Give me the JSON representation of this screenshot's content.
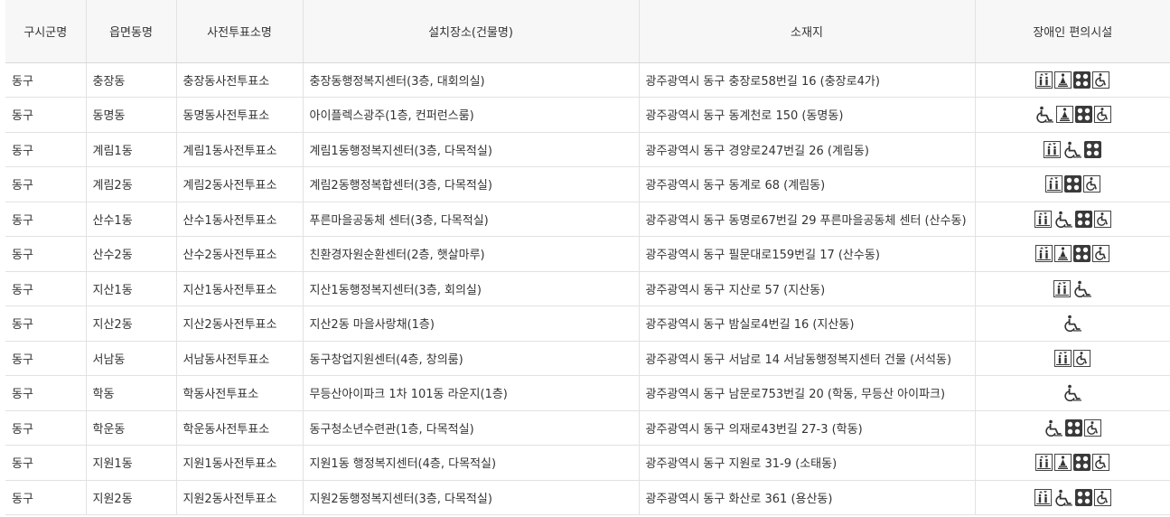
{
  "headers": [
    "구시군명",
    "읍면동명",
    "사전투표소명",
    "설치장소(건물명)",
    "소재지",
    "장애인 편의시설"
  ],
  "rows": [
    {
      "sigungu": "동구",
      "dong": "충장동",
      "station": "충장동사전투표소",
      "place": "충장동행정복지센터(3층, 대회의실)",
      "address": "광주광역시 동구 충장로58번길 16 (충장로4가)",
      "icons": [
        "elevator",
        "slope",
        "braille",
        "toilet"
      ]
    },
    {
      "sigungu": "동구",
      "dong": "동명동",
      "station": "동명동사전투표소",
      "place": "아이플렉스광주(1층, 컨퍼런스룸)",
      "address": "광주광역시 동구 동계천로 150 (동명동)",
      "icons": [
        "wheelchair",
        "slope",
        "braille",
        "toilet"
      ]
    },
    {
      "sigungu": "동구",
      "dong": "계림1동",
      "station": "계림1동사전투표소",
      "place": "계림1동행정복지센터(3층, 다목적실)",
      "address": "광주광역시 동구 경양로247번길 26 (계림동)",
      "icons": [
        "elevator",
        "wheelchair",
        "braille"
      ]
    },
    {
      "sigungu": "동구",
      "dong": "계림2동",
      "station": "계림2동사전투표소",
      "place": "계림2동행정복합센터(3층, 다목적실)",
      "address": "광주광역시 동구 동계로 68 (계림동)",
      "icons": [
        "elevator",
        "braille",
        "toilet"
      ]
    },
    {
      "sigungu": "동구",
      "dong": "산수1동",
      "station": "산수1동사전투표소",
      "place": "푸른마을공동체 센터(3층, 다목적실)",
      "address": "광주광역시 동구 동명로67번길 29 푸른마을공동체 센터 (산수동)",
      "icons": [
        "elevator",
        "wheelchair",
        "braille",
        "toilet"
      ]
    },
    {
      "sigungu": "동구",
      "dong": "산수2동",
      "station": "산수2동사전투표소",
      "place": "친환경자원순환센터(2층, 햇살마루)",
      "address": "광주광역시 동구 필문대로159번길 17 (산수동)",
      "icons": [
        "elevator",
        "slope",
        "braille",
        "toilet"
      ]
    },
    {
      "sigungu": "동구",
      "dong": "지산1동",
      "station": "지산1동사전투표소",
      "place": "지산1동행정복지센터(3층, 회의실)",
      "address": "광주광역시 동구 지산로 57 (지산동)",
      "icons": [
        "elevator",
        "wheelchair"
      ]
    },
    {
      "sigungu": "동구",
      "dong": "지산2동",
      "station": "지산2동사전투표소",
      "place": "지산2동 마을사랑채(1층)",
      "address": "광주광역시 동구 밤실로4번길 16 (지산동)",
      "icons": [
        "wheelchair"
      ]
    },
    {
      "sigungu": "동구",
      "dong": "서남동",
      "station": "서남동사전투표소",
      "place": "동구창업지원센터(4층, 창의룸)",
      "address": "광주광역시 동구 서남로 14 서남동행정복지센터 건물 (서석동)",
      "icons": [
        "elevator",
        "toilet"
      ]
    },
    {
      "sigungu": "동구",
      "dong": "학동",
      "station": "학동사전투표소",
      "place": "무등산아이파크 1차 101동 라운지(1층)",
      "address": "광주광역시 동구 남문로753번길 20 (학동, 무등산 아이파크)",
      "icons": [
        "wheelchair"
      ]
    },
    {
      "sigungu": "동구",
      "dong": "학운동",
      "station": "학운동사전투표소",
      "place": "동구청소년수련관(1층, 다목적실)",
      "address": "광주광역시 동구 의재로43번길 27-3 (학동)",
      "icons": [
        "wheelchair",
        "braille",
        "toilet"
      ]
    },
    {
      "sigungu": "동구",
      "dong": "지원1동",
      "station": "지원1동사전투표소",
      "place": "지원1동 행정복지센터(4층, 다목적실)",
      "address": "광주광역시 동구 지원로 31-9 (소태동)",
      "icons": [
        "elevator",
        "slope",
        "braille",
        "toilet"
      ]
    },
    {
      "sigungu": "동구",
      "dong": "지원2동",
      "station": "지원2동사전투표소",
      "place": "지원2동행정복지센터(3층, 다목적실)",
      "address": "광주광역시 동구 화산로 361 (용산동)",
      "icons": [
        "elevator",
        "wheelchair",
        "braille",
        "toilet"
      ]
    }
  ]
}
